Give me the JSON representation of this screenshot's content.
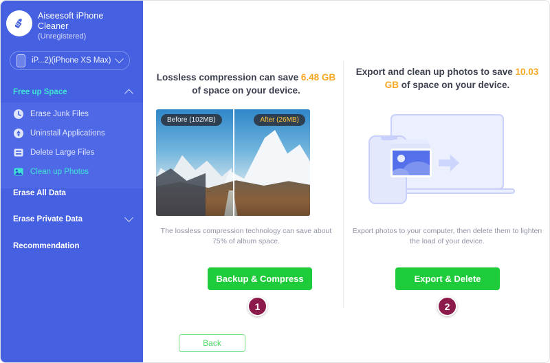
{
  "app": {
    "name": "Aiseesoft iPhone Cleaner",
    "registration": "(Unregistered)",
    "logo_icon": "broom-icon"
  },
  "device": {
    "label": "iP...2)(iPhone XS Max)",
    "icon": "phone-icon",
    "chevron": "chevron-down-icon"
  },
  "titlebar": {
    "icons": [
      {
        "name": "cart-icon",
        "title": "Cart"
      },
      {
        "name": "key-icon",
        "title": "Register"
      },
      {
        "name": "menu-icon",
        "title": "Menu"
      },
      {
        "name": "chat-icon",
        "title": "Feedback"
      },
      {
        "name": "minimize-icon",
        "title": "Minimize"
      },
      {
        "name": "close-icon",
        "title": "Close"
      }
    ]
  },
  "sidebar": {
    "accent_color": "#3fe3d4",
    "background_color": "#4560e0",
    "groups": [
      {
        "label": "Free up Space",
        "expanded": true,
        "chevron": "chevron-up-icon",
        "items": [
          {
            "label": "Erase Junk Files",
            "icon": "clock-icon",
            "selected": false
          },
          {
            "label": "Uninstall Applications",
            "icon": "apps-icon",
            "selected": false
          },
          {
            "label": "Delete Large Files",
            "icon": "window-icon",
            "selected": false
          },
          {
            "label": "Clean up Photos",
            "icon": "photo-icon",
            "selected": true
          }
        ]
      },
      {
        "label": "Erase All Data",
        "expanded": false,
        "chevron": "",
        "items": []
      },
      {
        "label": "Erase Private Data",
        "expanded": false,
        "chevron": "chevron-down-icon",
        "items": []
      },
      {
        "label": "Recommendation",
        "expanded": false,
        "chevron": "",
        "items": []
      }
    ]
  },
  "main": {
    "highlight_color": "#f7a823",
    "cta_color": "#1ecc3b",
    "badge_color": "#8c1a4b",
    "left": {
      "headline_part1": "Lossless compression can save ",
      "headline_value": "6.48 GB",
      "headline_part2": " of space on your device.",
      "image": {
        "before_tag": "Before (102MB)",
        "after_tag": "After (26MB)",
        "alt": "mountain-before-after-comparison"
      },
      "caption": "The lossless compression technology can save about 75% of album space.",
      "cta_label": "Backup & Compress",
      "badge": "1"
    },
    "right": {
      "headline_part1": "Export and clean up photos to save ",
      "headline_value": "10.03 GB",
      "headline_part2": " of space on your device.",
      "illustration": "phone-to-laptop-photo-transfer",
      "caption": "Export photos to your computer, then delete them to lighten the load of your device.",
      "cta_label": "Export & Delete",
      "badge": "2"
    },
    "back_label": "Back"
  }
}
